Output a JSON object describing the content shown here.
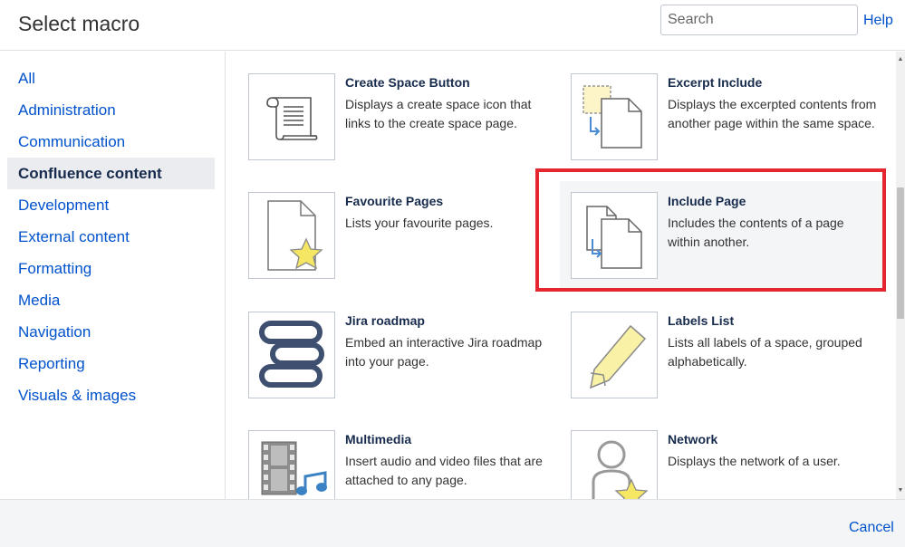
{
  "header": {
    "title": "Select macro",
    "search_placeholder": "Search",
    "help_label": "Help"
  },
  "sidebar": {
    "categories": [
      {
        "label": "All",
        "active": false
      },
      {
        "label": "Administration",
        "active": false
      },
      {
        "label": "Communication",
        "active": false
      },
      {
        "label": "Confluence content",
        "active": true
      },
      {
        "label": "Development",
        "active": false
      },
      {
        "label": "External content",
        "active": false
      },
      {
        "label": "Formatting",
        "active": false
      },
      {
        "label": "Media",
        "active": false
      },
      {
        "label": "Navigation",
        "active": false
      },
      {
        "label": "Reporting",
        "active": false
      },
      {
        "label": "Visuals & images",
        "active": false
      }
    ]
  },
  "macros": [
    {
      "name": "Create Space Button",
      "description": "Displays a create space icon that links to the create space page.",
      "icon": "scroll-document-icon"
    },
    {
      "name": "Excerpt Include",
      "description": "Displays the excerpted contents from another page within the same space.",
      "icon": "excerpt-include-icon"
    },
    {
      "name": "Favourite Pages",
      "description": "Lists your favourite pages.",
      "icon": "page-star-icon"
    },
    {
      "name": "Include Page",
      "description": "Includes the contents of a page within another.",
      "icon": "include-page-icon",
      "highlighted": true
    },
    {
      "name": "Jira roadmap",
      "description": "Embed an interactive Jira roadmap into your page.",
      "icon": "roadmap-bars-icon"
    },
    {
      "name": "Labels List",
      "description": "Lists all labels of a space, grouped alphabetically.",
      "icon": "label-tag-icon"
    },
    {
      "name": "Multimedia",
      "description": "Insert audio and video files that are attached to any page.",
      "icon": "film-music-icon"
    },
    {
      "name": "Network",
      "description": "Displays the network of a user.",
      "icon": "user-star-icon"
    }
  ],
  "footer": {
    "cancel_label": "Cancel"
  },
  "colors": {
    "link": "#0052cc",
    "highlight_border": "#e6262e",
    "active_category_bg": "#ebecf0"
  }
}
